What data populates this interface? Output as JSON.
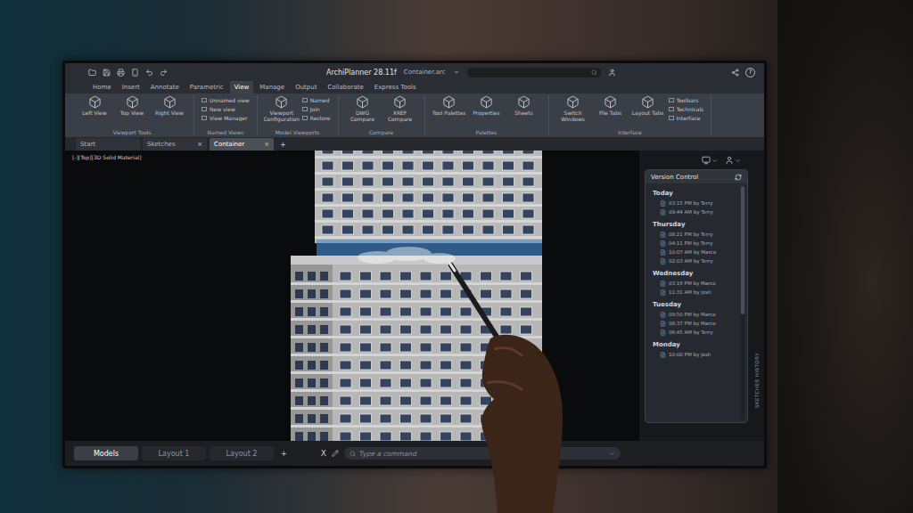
{
  "app": {
    "title": "ArchiPlanner 28.11f",
    "file": "Container.arc",
    "help": "?"
  },
  "ribbon_tabs": [
    {
      "label": "Home",
      "selected": false
    },
    {
      "label": "Insert",
      "selected": false
    },
    {
      "label": "Annotate",
      "selected": false
    },
    {
      "label": "Parametric",
      "selected": false
    },
    {
      "label": "View",
      "selected": true
    },
    {
      "label": "Manage",
      "selected": false
    },
    {
      "label": "Output",
      "selected": false
    },
    {
      "label": "Collaborate",
      "selected": false
    },
    {
      "label": "Express Tools",
      "selected": false
    }
  ],
  "ribbon_groups": [
    {
      "label": "Viewport Tools",
      "items": [
        {
          "label": "Left View",
          "kind": "large"
        },
        {
          "label": "Top View",
          "kind": "large"
        },
        {
          "label": "Right View",
          "kind": "large"
        }
      ]
    },
    {
      "label": "Named Views",
      "items": [
        {
          "label": "Unnamed view",
          "kind": "small"
        },
        {
          "label": "New view",
          "kind": "small"
        },
        {
          "label": "View Manager",
          "kind": "small"
        }
      ]
    },
    {
      "label": "Model Viewports",
      "items": [
        {
          "label": "Viewport Configuration",
          "kind": "large"
        },
        {
          "label": "Named",
          "kind": "small"
        },
        {
          "label": "Join",
          "kind": "small"
        },
        {
          "label": "Restore",
          "kind": "small"
        }
      ]
    },
    {
      "label": "Compare",
      "items": [
        {
          "label": "DWG Compare",
          "kind": "large"
        },
        {
          "label": "XREF Compare",
          "kind": "large"
        }
      ]
    },
    {
      "label": "Palettes",
      "items": [
        {
          "label": "Tool Palettes",
          "kind": "large"
        },
        {
          "label": "Properties",
          "kind": "large"
        },
        {
          "label": "Sheets",
          "kind": "large"
        }
      ]
    },
    {
      "label": "Interface",
      "items": [
        {
          "label": "Switch Windows",
          "kind": "large"
        },
        {
          "label": "File Tabs",
          "kind": "large"
        },
        {
          "label": "Layout Tabs",
          "kind": "large"
        },
        {
          "label": "Toolbars",
          "kind": "small"
        },
        {
          "label": "Technicals",
          "kind": "small"
        },
        {
          "label": "Interface",
          "kind": "small"
        }
      ]
    }
  ],
  "document_tabs": [
    {
      "label": "Start",
      "selected": false,
      "close": ""
    },
    {
      "label": "Sketches",
      "selected": false,
      "close": "×"
    },
    {
      "label": "Container",
      "selected": true,
      "close": "×"
    }
  ],
  "new_tab": "+",
  "viewport_label": "[-][Top][3D Solid Material]",
  "version_control": {
    "title": "Version Control",
    "side_label": "SKETCHES HISTORY",
    "groups": [
      {
        "day": "Today",
        "entries": [
          "03:15 PM by Terry",
          "09:44 AM by Terry"
        ]
      },
      {
        "day": "Thursday",
        "entries": [
          "08:21 PM by Terry",
          "04:11 PM by Terry",
          "10:07 AM by Marco",
          "02:03 AM by Terry"
        ]
      },
      {
        "day": "Wednesday",
        "entries": [
          "03:16 PM by Marco",
          "11:31 AM by Josh"
        ]
      },
      {
        "day": "Tuesday",
        "entries": [
          "09:50 PM by Marco",
          "08:37 PM by Marco",
          "06:45 AM by Terry"
        ]
      },
      {
        "day": "Monday",
        "entries": [
          "10:00 PM by Josh"
        ]
      }
    ]
  },
  "layout_tabs": [
    {
      "label": "Models",
      "selected": true
    },
    {
      "label": "Layout 1",
      "selected": false
    },
    {
      "label": "Layout 2",
      "selected": false
    }
  ],
  "layout_add": "+",
  "command_bar": {
    "close": "X",
    "placeholder": "Type a command"
  }
}
